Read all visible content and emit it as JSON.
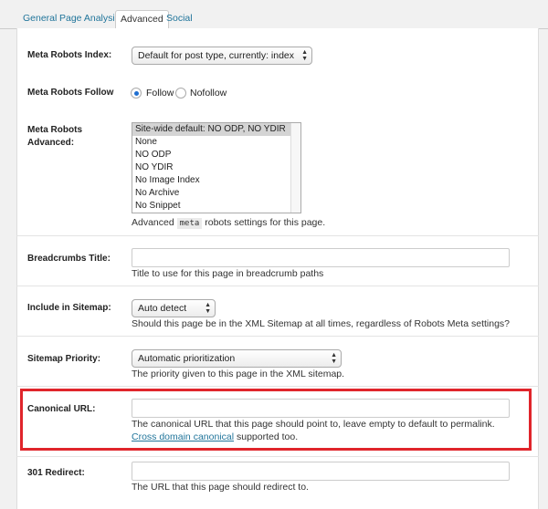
{
  "tabs": [
    {
      "label": "General"
    },
    {
      "label": "Page Analysis"
    },
    {
      "label": "Advanced",
      "active": true
    },
    {
      "label": "Social"
    }
  ],
  "robots_index": {
    "label": "Meta Robots Index:",
    "selected": "Default for post type, currently: index"
  },
  "robots_follow": {
    "label": "Meta Robots Follow",
    "options": [
      "Follow",
      "Nofollow"
    ],
    "selected": "Follow"
  },
  "robots_advanced": {
    "label_line1": "Meta Robots",
    "label_line2": "Advanced:",
    "options": [
      "Site-wide default: NO ODP, NO YDIR",
      "None",
      "NO ODP",
      "NO YDIR",
      "No Image Index",
      "No Archive",
      "No Snippet"
    ],
    "selected_index": 0,
    "desc_before": "Advanced",
    "desc_code": "meta",
    "desc_after": "robots settings for this page."
  },
  "breadcrumbs": {
    "label": "Breadcrumbs Title:",
    "value": "",
    "desc": "Title to use for this page in breadcrumb paths"
  },
  "sitemap_include": {
    "label": "Include in Sitemap:",
    "selected": "Auto detect",
    "desc": "Should this page be in the XML Sitemap at all times, regardless of Robots Meta settings?"
  },
  "sitemap_priority": {
    "label": "Sitemap Priority:",
    "selected": "Automatic prioritization",
    "desc": "The priority given to this page in the XML sitemap."
  },
  "canonical": {
    "label": "Canonical URL:",
    "value": "",
    "desc": "The canonical URL that this page should point to, leave empty to default to permalink.",
    "link_text": "Cross domain canonical",
    "desc_after_link": "supported too.",
    "highlight_color": "#e0252b"
  },
  "redirect": {
    "label": "301 Redirect:",
    "value": "",
    "desc": "The URL that this page should redirect to."
  },
  "colors": {
    "link": "#21759b",
    "radio_selected": "#1f6fd1"
  }
}
